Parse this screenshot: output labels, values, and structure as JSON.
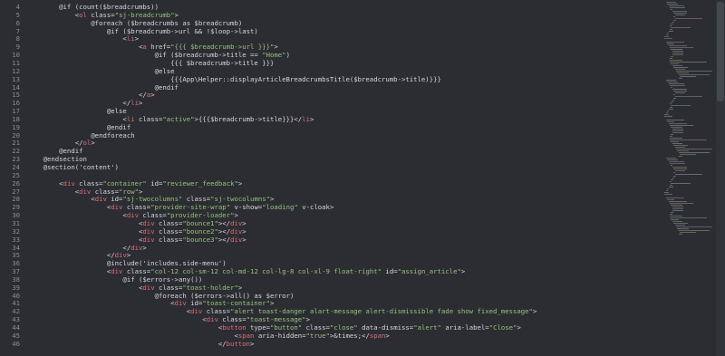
{
  "editor": {
    "lines": [
      {
        "n": "4",
        "t": "        @if (count($breadcrumbs))"
      },
      {
        "n": "5",
        "t": "            <ol class=\"sj-breadcrumb\">"
      },
      {
        "n": "6",
        "t": "                @foreach ($breadcrumbs as $breadcrumb)"
      },
      {
        "n": "7",
        "t": "                    @if ($breadcrumb->url && !$loop->last)"
      },
      {
        "n": "8",
        "t": "                        <li>"
      },
      {
        "n": "9",
        "t": "                            <a href=\"{{{ $breadcrumb->url }}}\">"
      },
      {
        "n": "10",
        "t": "                                @if ($breadcrumb->title == \"Home\")"
      },
      {
        "n": "11",
        "t": "                                    {{{ $breadcrumb->title }}}"
      },
      {
        "n": "12",
        "t": "                                @else"
      },
      {
        "n": "13",
        "t": "                                    {{{App\\Helper::displayArticleBreadcrumbsTitle($breadcrumb->title)}}}"
      },
      {
        "n": "14",
        "t": "                                @endif"
      },
      {
        "n": "15",
        "t": "                            </a>"
      },
      {
        "n": "16",
        "t": "                        </li>"
      },
      {
        "n": "17",
        "t": "                    @else"
      },
      {
        "n": "18",
        "t": "                        <li class=\"active\">{{{$breadcrumb->title}}}</li>"
      },
      {
        "n": "19",
        "t": "                    @endif"
      },
      {
        "n": "20",
        "t": "                @endforeach"
      },
      {
        "n": "21",
        "t": "            </ol>"
      },
      {
        "n": "22",
        "t": "        @endif"
      },
      {
        "n": "23",
        "t": "    @endsection"
      },
      {
        "n": "24",
        "t": "    @section('content')"
      },
      {
        "n": "25",
        "t": ""
      },
      {
        "n": "26",
        "t": "        <div class=\"container\" id=\"reviewer_feedback\">"
      },
      {
        "n": "27",
        "t": "            <div class=\"row\">"
      },
      {
        "n": "28",
        "t": "                <div id=\"sj-twocolumns\" class=\"sj-twocolumns\">"
      },
      {
        "n": "29",
        "t": "                    <div class=\"provider-site-wrap\" v-show=\"loading\" v-cloak>"
      },
      {
        "n": "30",
        "t": "                        <div class=\"provider-loader\">"
      },
      {
        "n": "31",
        "t": "                            <div class=\"bounce1\"></div>"
      },
      {
        "n": "32",
        "t": "                            <div class=\"bounce2\"></div>"
      },
      {
        "n": "33",
        "t": "                            <div class=\"bounce3\"></div>"
      },
      {
        "n": "34",
        "t": "                        </div>"
      },
      {
        "n": "35",
        "t": "                    </div>"
      },
      {
        "n": "36",
        "t": "                    @include('includes.side-menu')"
      },
      {
        "n": "37",
        "t": "                    <div class=\"col-12 col-sm-12 col-md-12 col-lg-8 col-xl-9 float-right\" id=\"assign_article\">"
      },
      {
        "n": "38",
        "t": "                        @if ($errors->any())"
      },
      {
        "n": "39",
        "t": "                            <div class=\"toast-holder\">"
      },
      {
        "n": "40",
        "t": "                                @foreach ($errors->all() as $error)"
      },
      {
        "n": "41",
        "t": "                                    <div id=\"toast-container\">"
      },
      {
        "n": "42",
        "t": "                                        <div class=\"alert toast-danger alart-message alert-dismissible fade show fixed_message\">"
      },
      {
        "n": "43",
        "t": "                                            <div class=\"toast-message\">"
      },
      {
        "n": "44",
        "t": "                                                <button type=\"button\" class=\"close\" data-dismiss=\"alert\" aria-label=\"Close\">"
      },
      {
        "n": "45",
        "t": "                                                    <span aria-hidden=\"true\">&times;</span>"
      },
      {
        "n": "46",
        "t": "                                                </button>"
      }
    ]
  },
  "colors": {
    "background": "#2b2d33",
    "text": "#d8d8d8",
    "line_number": "#8a8d94",
    "tag": "#e06c75",
    "string": "#98c379"
  }
}
